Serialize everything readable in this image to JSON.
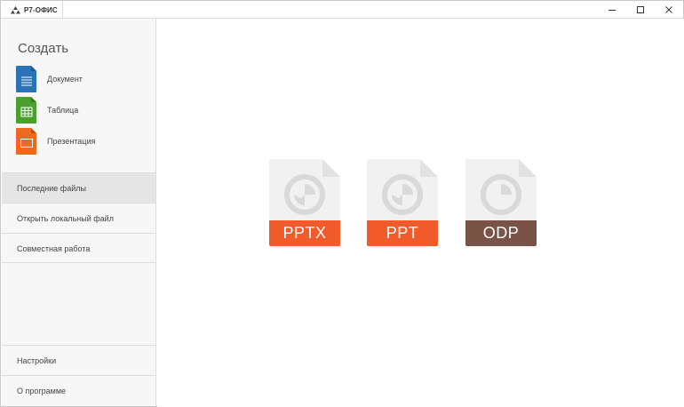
{
  "titlebar": {
    "tab_title": "Р7-ОФИС"
  },
  "sidebar": {
    "create_title": "Создать",
    "create_items": [
      {
        "label": "Документ",
        "icon": "document-file-icon",
        "color": "#2b73b6"
      },
      {
        "label": "Таблица",
        "icon": "spreadsheet-file-icon",
        "color": "#4aa02c"
      },
      {
        "label": "Презентация",
        "icon": "presentation-file-icon",
        "color": "#ee6a1c"
      }
    ],
    "menu_items": [
      {
        "label": "Последние файлы",
        "active": true
      },
      {
        "label": "Открыть локальный файл",
        "active": false
      },
      {
        "label": "Совместная работа",
        "active": false
      }
    ],
    "bottom_items": [
      {
        "label": "Настройки"
      },
      {
        "label": "О программе"
      }
    ]
  },
  "main": {
    "formats": [
      {
        "label": "PPTX",
        "color": "#f15a2b",
        "icon": "pptx-file-icon"
      },
      {
        "label": "PPT",
        "color": "#f15a2b",
        "icon": "ppt-file-icon"
      },
      {
        "label": "ODP",
        "color": "#7a5347",
        "icon": "odp-file-icon"
      }
    ]
  },
  "colors": {
    "sidebar_bg": "#f7f7f7",
    "active_item_bg": "#e5e5e5",
    "file_icon_body": "#f1f1f1",
    "file_icon_glyph": "#d9d9d9"
  }
}
